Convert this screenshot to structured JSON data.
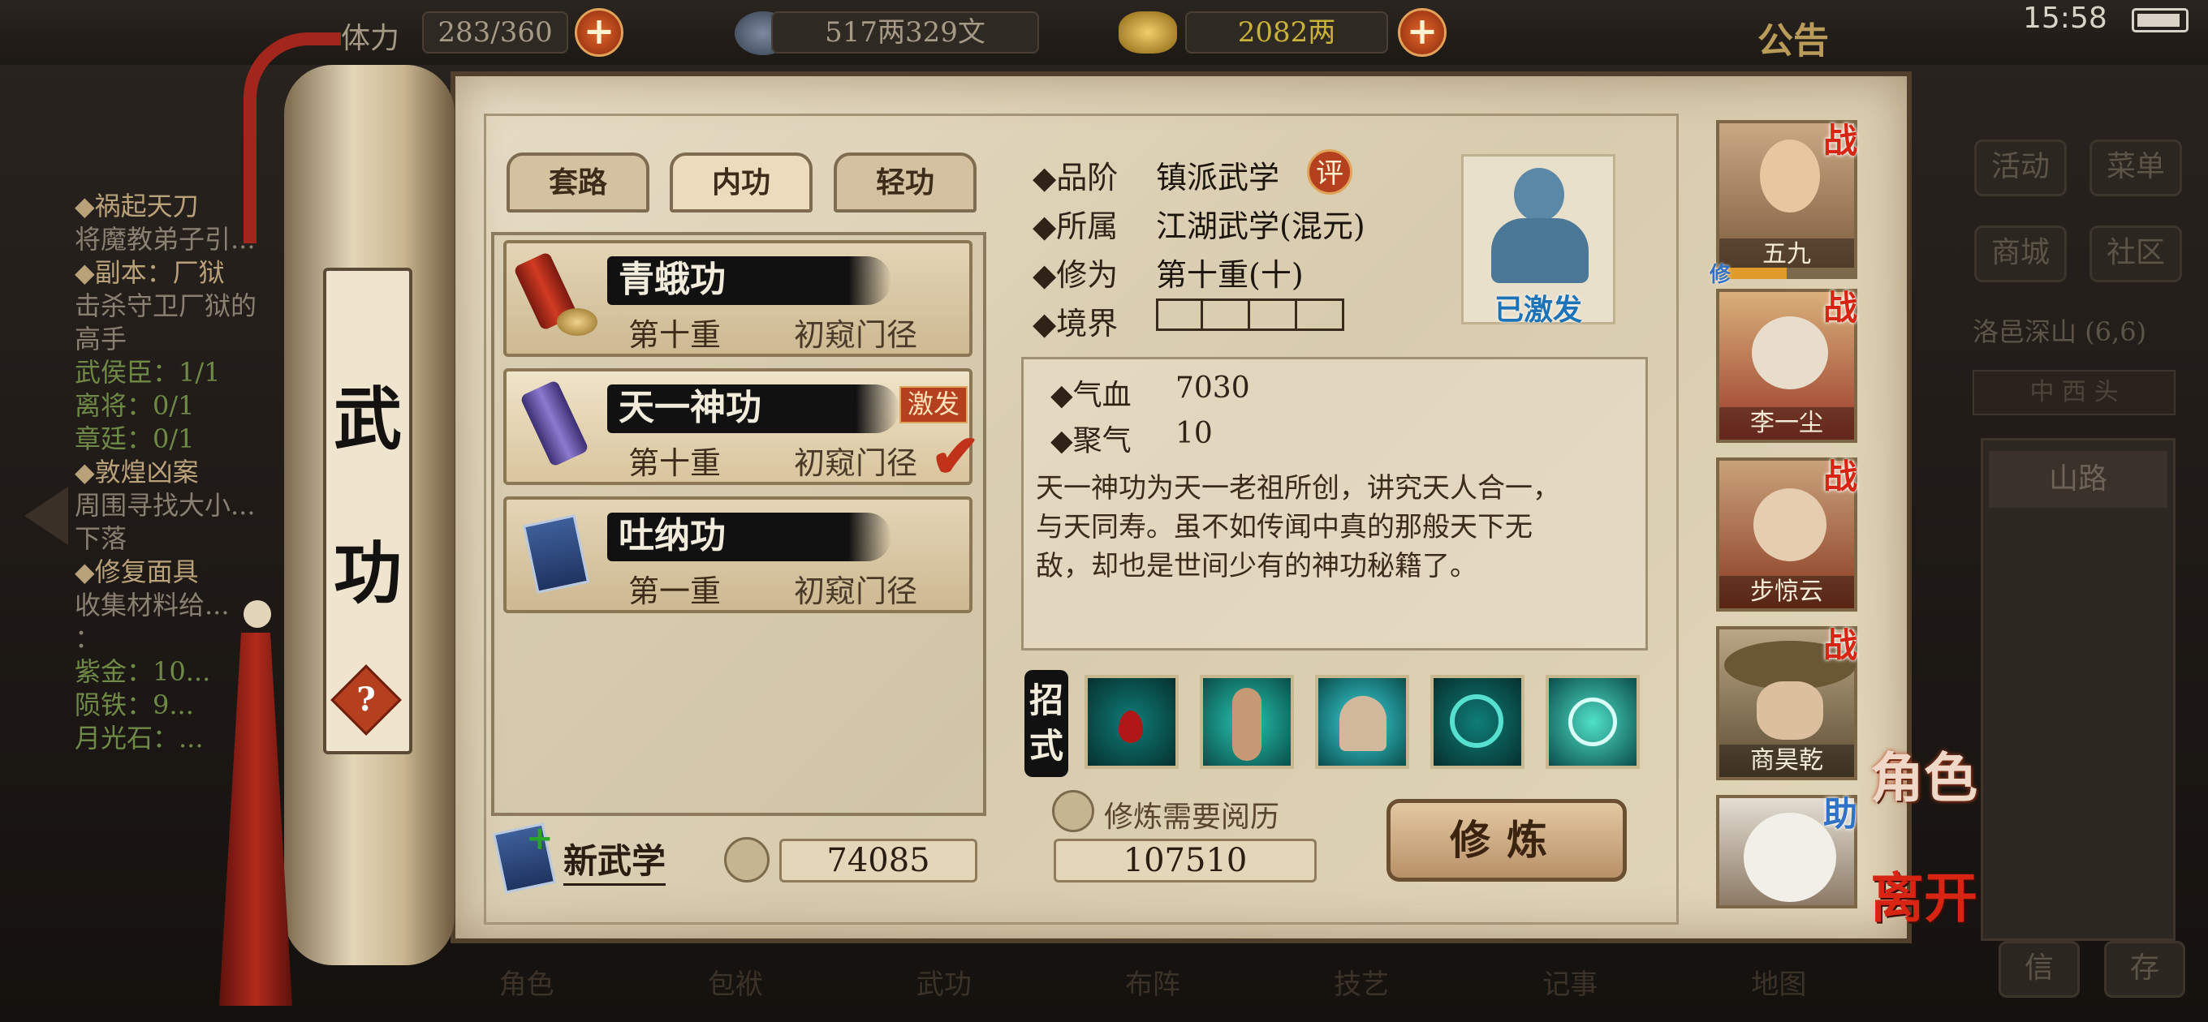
{
  "status": {
    "time": "15:58"
  },
  "topbar": {
    "stamina_label": "体力",
    "stamina": "283/360",
    "silver": "517两329文",
    "gold": "2082两",
    "notice": "公告"
  },
  "quests": [
    {
      "title": "◆祸起天刀",
      "lines": [
        "将魔教弟子引..."
      ]
    },
    {
      "title": "◆副本：厂狱",
      "lines": [
        "击杀守卫厂狱的",
        "高手"
      ],
      "sub": [
        "武侯臣：1/1",
        "离将：0/1",
        "章廷：0/1"
      ]
    },
    {
      "title": "◆敦煌凶案",
      "lines": [
        "周围寻找大小...",
        "下落"
      ]
    },
    {
      "title": "◆修复面具",
      "lines": [
        "收集材料给...",
        "："
      ],
      "sub": [
        "紫金：10...",
        "陨铁：9...",
        "月光石：..."
      ]
    }
  ],
  "scroll": {
    "label_1": "武",
    "label_2": "功",
    "help": "?"
  },
  "tabs": [
    {
      "label": "套路"
    },
    {
      "label": "内功"
    },
    {
      "label": "轻功"
    }
  ],
  "skills": [
    {
      "name": "青蛾功",
      "level": "第十重",
      "stage": "初窥门径",
      "icon": "scroll-red-icon"
    },
    {
      "name": "天一神功",
      "level": "第十重",
      "stage": "初窥门径",
      "badge": "激发",
      "checked": true,
      "icon": "scroll-purple-icon"
    },
    {
      "name": "吐纳功",
      "level": "第一重",
      "stage": "初窥门径",
      "icon": "book-blue-icon"
    }
  ],
  "detail": {
    "grade_label": "◆品阶",
    "grade": "镇派武学",
    "ping": "评",
    "belong_label": "◆所属",
    "belong": "江湖武学(混元)",
    "cult_label": "◆修为",
    "cult": "第十重(十)",
    "realm_label": "◆境界",
    "activated": "已激发",
    "stats": [
      {
        "label": "◆气血",
        "value": "7030"
      },
      {
        "label": "◆聚气",
        "value": "10"
      }
    ],
    "desc": [
      "天一神功为天一老祖所创，讲究天人合一，",
      "与天同寿。虽不如传闻中真的那般天下无",
      "敌，却也是世间少有的神功秘籍了。"
    ],
    "moves_label_1": "招",
    "moves_label_2": "式",
    "moves": [
      "blood-vortex-icon",
      "body-aura-icon",
      "meditation-icon",
      "palm-strike-icon",
      "shield-aura-icon"
    ],
    "req_label": "修炼需要阅历",
    "req_value": "107510",
    "train": "修炼"
  },
  "footer": {
    "new_label": "新武学",
    "exp_value": "74085"
  },
  "party": [
    {
      "name": "五九",
      "tag": "战",
      "extra": "修"
    },
    {
      "name": "李一尘",
      "tag": "战"
    },
    {
      "name": "步惊云",
      "tag": "战"
    },
    {
      "name": "商昊乾",
      "tag": "战"
    },
    {
      "name": "",
      "tag": "助"
    }
  ],
  "side_right": {
    "role": "角色",
    "leave": "离开",
    "btns": [
      "活动",
      "菜单",
      "商城",
      "社区"
    ],
    "location": "洛邑深山",
    "coords": "(6,6)",
    "compass": "中 西 头",
    "road": "山路",
    "b1": "信",
    "b2": "存"
  },
  "bottom_nav": [
    "角色",
    "包袱",
    "武功",
    "布阵",
    "技艺",
    "记事",
    "地图"
  ],
  "colors": {
    "accent": "#b5401f",
    "check": "#c0321a",
    "war": "#d82412",
    "assist": "#3072c8"
  }
}
